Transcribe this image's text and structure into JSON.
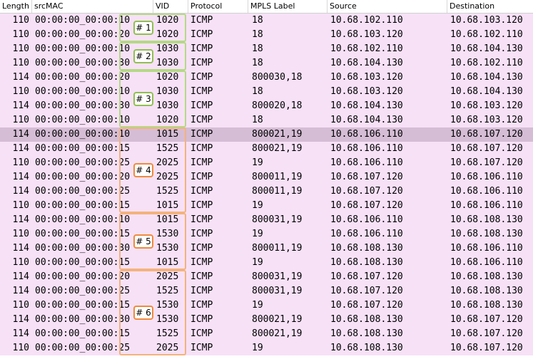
{
  "columns": {
    "length": "Length",
    "srcmac": "srcMAC",
    "vid": "VID",
    "protocol": "Protocol",
    "mpls": "MPLS Label",
    "source": "Source",
    "destination": "Destination"
  },
  "selected_row_index": 8,
  "colors": {
    "row_background": "#f7e1f7",
    "selected_row_background": "#d5bdd5",
    "group_green": "#b4d984",
    "group_orange": "#f4b27c"
  },
  "rows": [
    {
      "length": "110",
      "srcmac": "00:00:00_00:00:10",
      "vid": "1020",
      "protocol": "ICMP",
      "mpls": "18",
      "source": "10.68.102.110",
      "destination": "10.68.103.120"
    },
    {
      "length": "110",
      "srcmac": "00:00:00_00:00:20",
      "vid": "1020",
      "protocol": "ICMP",
      "mpls": "18",
      "source": "10.68.103.120",
      "destination": "10.68.102.110"
    },
    {
      "length": "110",
      "srcmac": "00:00:00_00:00:10",
      "vid": "1030",
      "protocol": "ICMP",
      "mpls": "18",
      "source": "10.68.102.110",
      "destination": "10.68.104.130"
    },
    {
      "length": "110",
      "srcmac": "00:00:00_00:00:30",
      "vid": "1030",
      "protocol": "ICMP",
      "mpls": "18",
      "source": "10.68.104.130",
      "destination": "10.68.102.110"
    },
    {
      "length": "114",
      "srcmac": "00:00:00_00:00:20",
      "vid": "1020",
      "protocol": "ICMP",
      "mpls": "800030,18",
      "source": "10.68.103.120",
      "destination": "10.68.104.130"
    },
    {
      "length": "110",
      "srcmac": "00:00:00_00:00:10",
      "vid": "1030",
      "protocol": "ICMP",
      "mpls": "18",
      "source": "10.68.103.120",
      "destination": "10.68.104.130"
    },
    {
      "length": "114",
      "srcmac": "00:00:00_00:00:30",
      "vid": "1030",
      "protocol": "ICMP",
      "mpls": "800020,18",
      "source": "10.68.104.130",
      "destination": "10.68.103.120"
    },
    {
      "length": "110",
      "srcmac": "00:00:00_00:00:10",
      "vid": "1020",
      "protocol": "ICMP",
      "mpls": "18",
      "source": "10.68.104.130",
      "destination": "10.68.103.120"
    },
    {
      "length": "114",
      "srcmac": "00:00:00_00:00:10",
      "vid": "1015",
      "protocol": "ICMP",
      "mpls": "800021,19",
      "source": "10.68.106.110",
      "destination": "10.68.107.120"
    },
    {
      "length": "114",
      "srcmac": "00:00:00_00:00:15",
      "vid": "1525",
      "protocol": "ICMP",
      "mpls": "800021,19",
      "source": "10.68.106.110",
      "destination": "10.68.107.120"
    },
    {
      "length": "110",
      "srcmac": "00:00:00_00:00:25",
      "vid": "2025",
      "protocol": "ICMP",
      "mpls": "19",
      "source": "10.68.106.110",
      "destination": "10.68.107.120"
    },
    {
      "length": "114",
      "srcmac": "00:00:00_00:00:20",
      "vid": "2025",
      "protocol": "ICMP",
      "mpls": "800011,19",
      "source": "10.68.107.120",
      "destination": "10.68.106.110"
    },
    {
      "length": "114",
      "srcmac": "00:00:00_00:00:25",
      "vid": "1525",
      "protocol": "ICMP",
      "mpls": "800011,19",
      "source": "10.68.107.120",
      "destination": "10.68.106.110"
    },
    {
      "length": "110",
      "srcmac": "00:00:00_00:00:15",
      "vid": "1015",
      "protocol": "ICMP",
      "mpls": "19",
      "source": "10.68.107.120",
      "destination": "10.68.106.110"
    },
    {
      "length": "114",
      "srcmac": "00:00:00_00:00:10",
      "vid": "1015",
      "protocol": "ICMP",
      "mpls": "800031,19",
      "source": "10.68.106.110",
      "destination": "10.68.108.130"
    },
    {
      "length": "110",
      "srcmac": "00:00:00_00:00:15",
      "vid": "1530",
      "protocol": "ICMP",
      "mpls": "19",
      "source": "10.68.106.110",
      "destination": "10.68.108.130"
    },
    {
      "length": "114",
      "srcmac": "00:00:00_00:00:30",
      "vid": "1530",
      "protocol": "ICMP",
      "mpls": "800011,19",
      "source": "10.68.108.130",
      "destination": "10.68.106.110"
    },
    {
      "length": "110",
      "srcmac": "00:00:00_00:00:15",
      "vid": "1015",
      "protocol": "ICMP",
      "mpls": "19",
      "source": "10.68.108.130",
      "destination": "10.68.106.110"
    },
    {
      "length": "114",
      "srcmac": "00:00:00_00:00:20",
      "vid": "2025",
      "protocol": "ICMP",
      "mpls": "800031,19",
      "source": "10.68.107.120",
      "destination": "10.68.108.130"
    },
    {
      "length": "114",
      "srcmac": "00:00:00_00:00:25",
      "vid": "1525",
      "protocol": "ICMP",
      "mpls": "800031,19",
      "source": "10.68.107.120",
      "destination": "10.68.108.130"
    },
    {
      "length": "110",
      "srcmac": "00:00:00_00:00:15",
      "vid": "1530",
      "protocol": "ICMP",
      "mpls": "19",
      "source": "10.68.107.120",
      "destination": "10.68.108.130"
    },
    {
      "length": "114",
      "srcmac": "00:00:00_00:00:30",
      "vid": "1530",
      "protocol": "ICMP",
      "mpls": "800021,19",
      "source": "10.68.108.130",
      "destination": "10.68.107.120"
    },
    {
      "length": "114",
      "srcmac": "00:00:00_00:00:15",
      "vid": "1525",
      "protocol": "ICMP",
      "mpls": "800021,19",
      "source": "10.68.108.130",
      "destination": "10.68.107.120"
    },
    {
      "length": "110",
      "srcmac": "00:00:00_00:00:25",
      "vid": "2025",
      "protocol": "ICMP",
      "mpls": "19",
      "source": "10.68.108.130",
      "destination": "10.68.107.120"
    }
  ],
  "groups": [
    {
      "label": "# 1",
      "color": "green",
      "first_row": 0,
      "last_row": 1
    },
    {
      "label": "# 2",
      "color": "green",
      "first_row": 2,
      "last_row": 3
    },
    {
      "label": "# 3",
      "color": "green",
      "first_row": 4,
      "last_row": 7
    },
    {
      "label": "# 4",
      "color": "orange",
      "first_row": 8,
      "last_row": 13
    },
    {
      "label": "# 5",
      "color": "orange",
      "first_row": 14,
      "last_row": 17
    },
    {
      "label": "# 6",
      "color": "orange",
      "first_row": 18,
      "last_row": 23
    }
  ]
}
